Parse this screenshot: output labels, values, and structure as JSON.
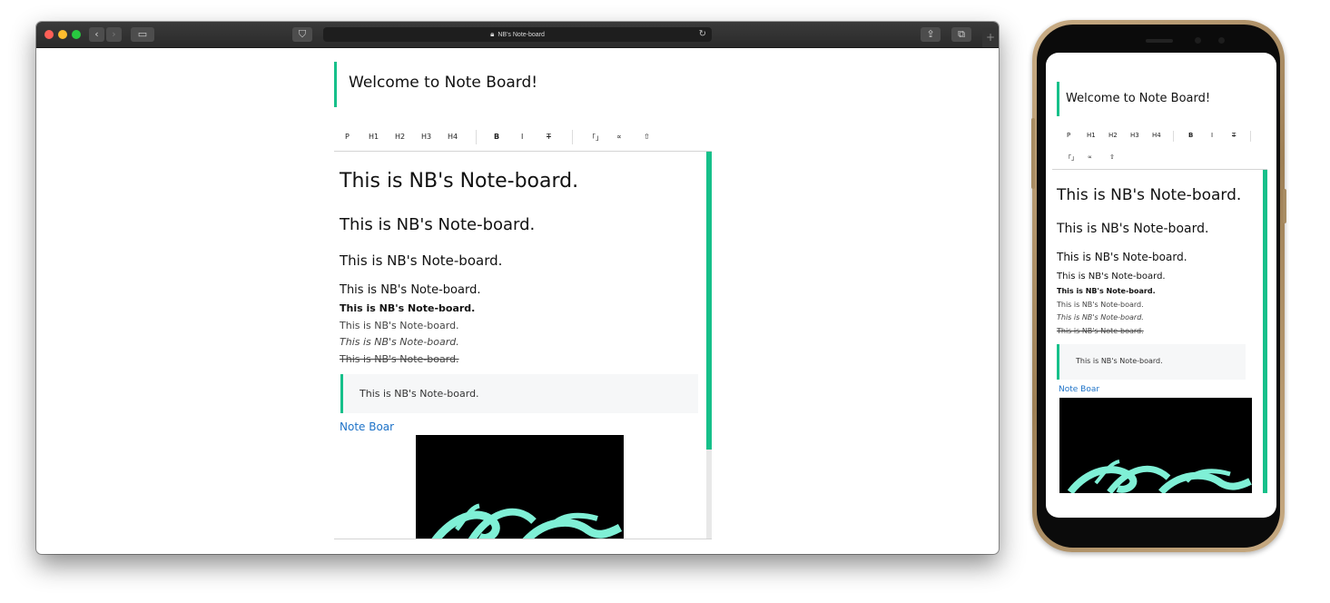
{
  "browser": {
    "url_title": "NB's Note-board",
    "lock_icon": "lock-icon",
    "reload_icon": "reload-icon",
    "new_tab": "+"
  },
  "board": {
    "title": "Welcome to Note Board!",
    "toolbar": [
      "P",
      "H1",
      "H2",
      "H3",
      "H4",
      "B",
      "I",
      "T",
      "「」",
      "∝",
      "⇧"
    ],
    "lines": {
      "h1": "This is NB's Note-board.",
      "h2": "This is NB's Note-board.",
      "h3": "This is NB's Note-board.",
      "h4": "This is NB's Note-board.",
      "bold": "This is NB's Note-board.",
      "p": "This is NB's Note-board.",
      "italic": "This is NB's Note-board.",
      "strike": "This is NB's Note-board.",
      "quote": "This is NB's Note-board.",
      "link_desktop": "Note Boar",
      "link_mobile": "Note Boar"
    },
    "accent_color": "#16c08a",
    "link_color": "#1e73c8"
  }
}
